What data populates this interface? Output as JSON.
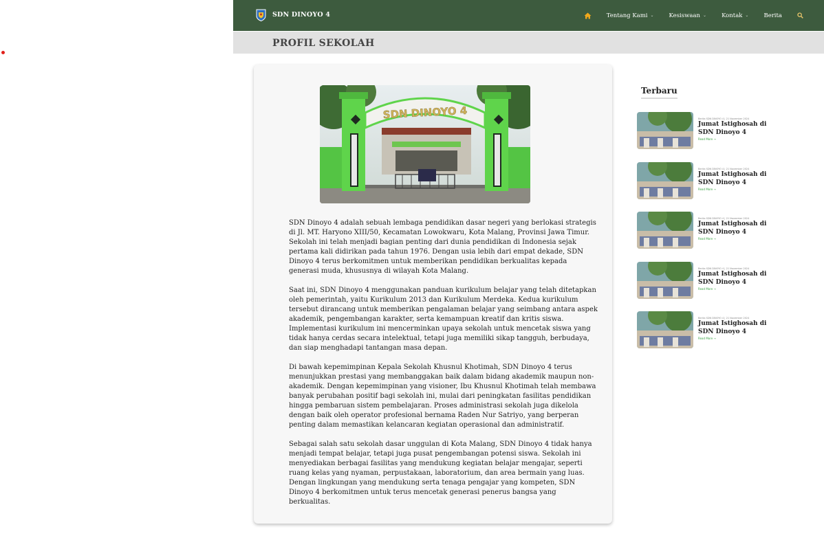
{
  "brand": {
    "name": "SDN DINOYO 4"
  },
  "nav": {
    "items": [
      {
        "label": "Tentang Kami",
        "caret": "⌄"
      },
      {
        "label": "Kesiswaan",
        "caret": "⌄"
      },
      {
        "label": "Kontak",
        "caret": "⌄"
      },
      {
        "label": "Berita"
      }
    ],
    "icons": {
      "home": "home-icon",
      "search": "search-icon"
    }
  },
  "page": {
    "title": "PROFIL SEKOLAH"
  },
  "hero": {
    "sign_text": "SDN DINOYO 4"
  },
  "article": {
    "paragraphs": [
      "SDN Dinoyo 4 adalah sebuah lembaga pendidikan dasar negeri yang berlokasi strategis di Jl. MT. Haryono XIII/50, Kecamatan Lowokwaru, Kota Malang, Provinsi Jawa Timur. Sekolah ini telah menjadi bagian penting dari dunia pendidikan di Indonesia sejak pertama kali didirikan pada tahun 1976. Dengan usia lebih dari empat dekade, SDN Dinoyo 4 terus berkomitmen untuk memberikan pendidikan berkualitas kepada generasi muda, khususnya di wilayah Kota Malang.",
      "Saat ini, SDN Dinoyo 4 menggunakan panduan kurikulum belajar yang telah ditetapkan oleh pemerintah, yaitu Kurikulum 2013 dan Kurikulum Merdeka. Kedua kurikulum tersebut dirancang untuk memberikan pengalaman belajar yang seimbang antara aspek akademik, pengembangan karakter, serta kemampuan kreatif dan kritis siswa. Implementasi kurikulum ini mencerminkan upaya sekolah untuk mencetak siswa yang tidak hanya cerdas secara intelektual, tetapi juga memiliki sikap tangguh, berbudaya, dan siap menghadapi tantangan masa depan.",
      "Di bawah kepemimpinan Kepala Sekolah Khusnul Khotimah, SDN Dinoyo 4 terus menunjukkan prestasi yang membanggakan baik dalam bidang akademik maupun non-akademik. Dengan kepemimpinan yang visioner, Ibu Khusnul Khotimah telah membawa banyak perubahan positif bagi sekolah ini, mulai dari peningkatan fasilitas pendidikan hingga pembaruan sistem pembelajaran. Proses administrasi sekolah juga dikelola dengan baik oleh operator profesional bernama Raden Nur Satriyo, yang berperan penting dalam memastikan kelancaran kegiatan operasional dan administratif.",
      "Sebagai salah satu sekolah dasar unggulan di Kota Malang, SDN Dinoyo 4 tidak hanya menjadi tempat belajar, tetapi juga pusat pengembangan potensi siswa. Sekolah ini menyediakan berbagai fasilitas yang mendukung kegiatan belajar mengajar, seperti ruang kelas yang nyaman, perpustakaan, laboratorium, dan area bermain yang luas. Dengan lingkungan yang mendukung serta tenaga pengajar yang kompeten, SDN Dinoyo 4 berkomitmen untuk terus mencetak generasi penerus bangsa yang berkualitas."
    ]
  },
  "sidebar": {
    "title": "Terbaru",
    "posts": [
      {
        "meta": "Berita SDN DINOYO 4 | 21 November 2024",
        "title": "Jumat Istighosah di SDN Dinoyo 4",
        "readmore": "Read More →"
      },
      {
        "meta": "Berita SDN DINOYO 4 | 21 November 2024",
        "title": "Jumat Istighosah di SDN Dinoyo 4",
        "readmore": "Read More →"
      },
      {
        "meta": "Berita SDN DINOYO 4 | 21 November 2024",
        "title": "Jumat Istighosah di SDN Dinoyo 4",
        "readmore": "Read More →"
      },
      {
        "meta": "Berita SDN DINOYO 4 | 21 November 2024",
        "title": "Jumat Istighosah di SDN Dinoyo 4",
        "readmore": "Read More →"
      },
      {
        "meta": "Berita SDN DINOYO 4 | 21 November 2024",
        "title": "Jumat Istighosah di SDN Dinoyo 4",
        "readmore": "Read More →"
      }
    ]
  },
  "colors": {
    "navbar": "#3d5b3e",
    "title_band": "#e1e1e1",
    "accent_home": "#f0a81c",
    "readmore": "#3aa344",
    "cursor_dot": "#e0201b"
  }
}
